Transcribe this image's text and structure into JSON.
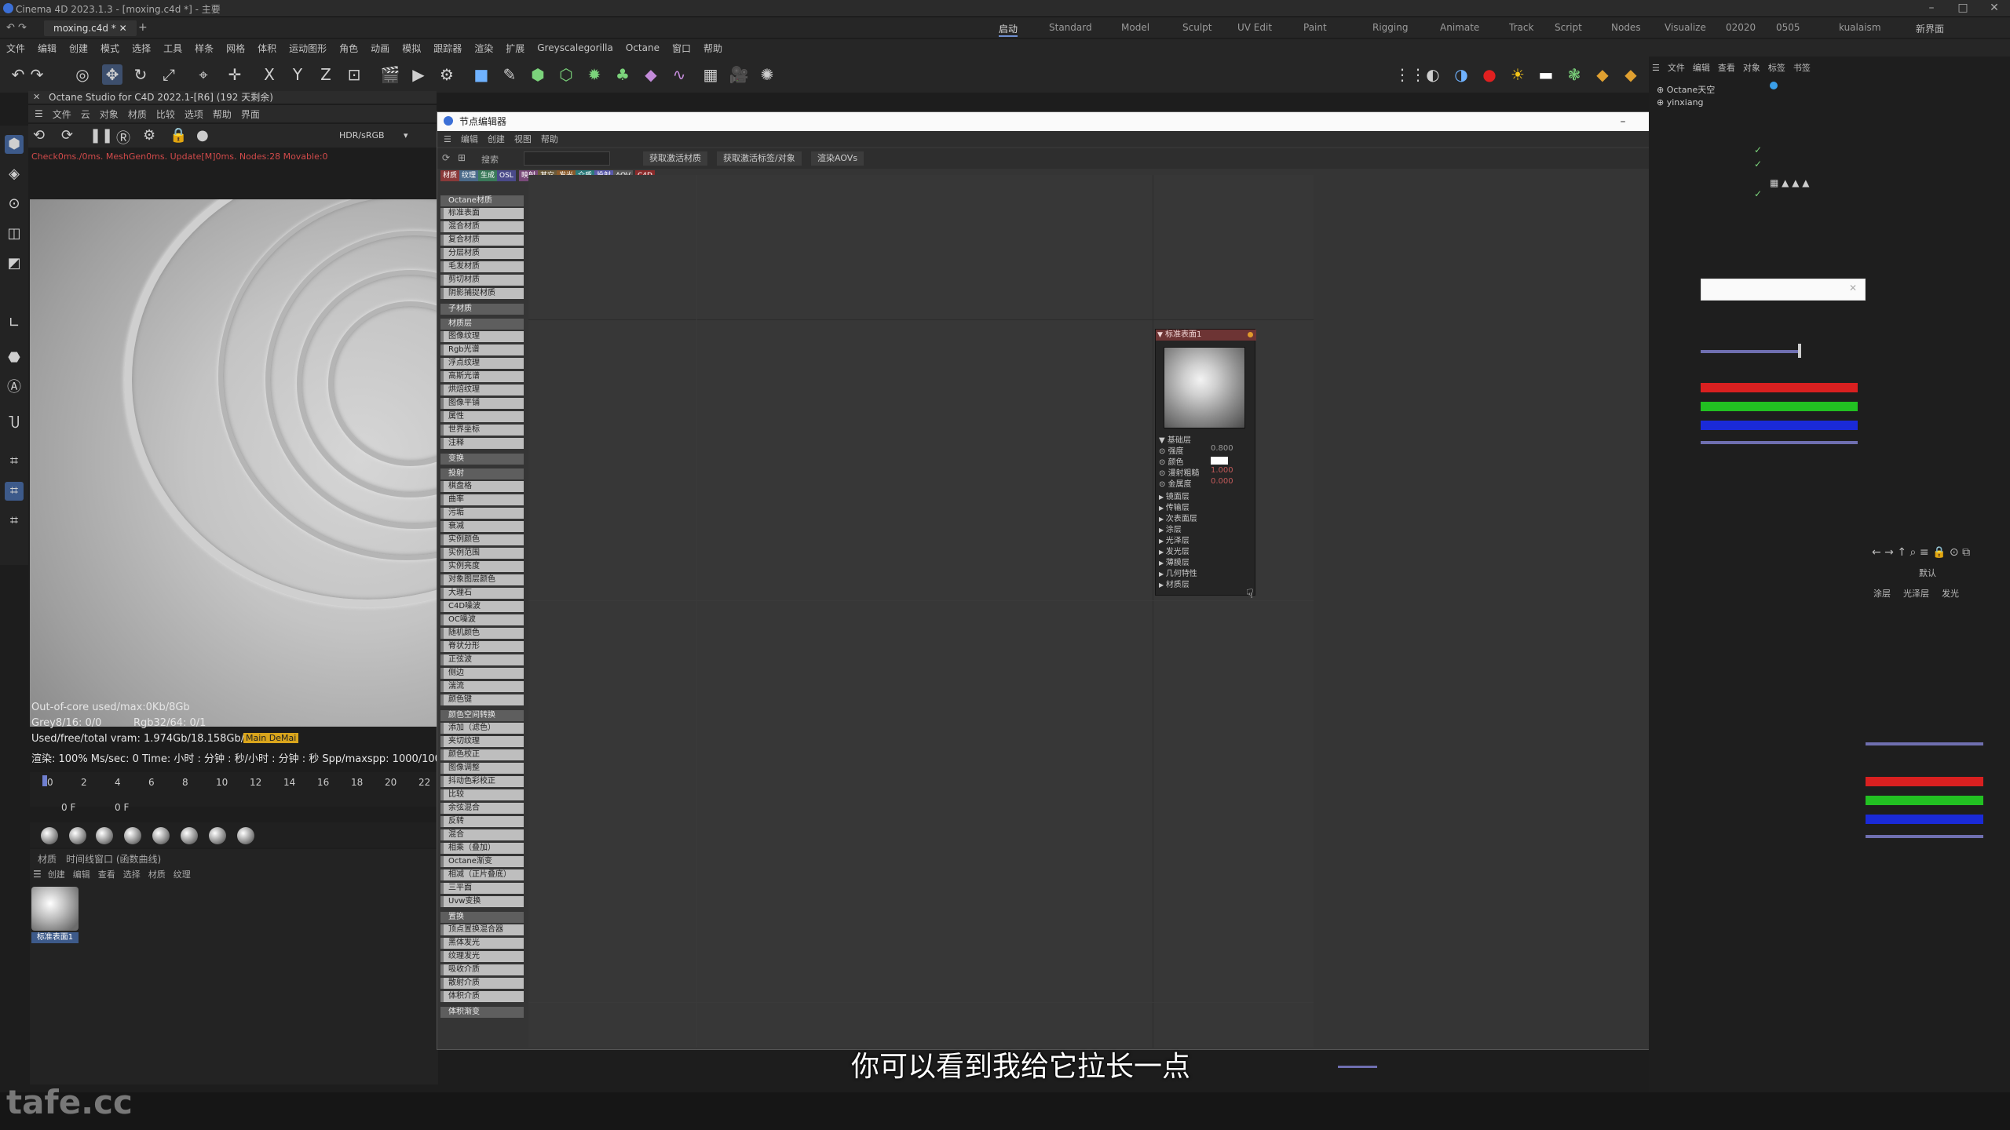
{
  "titlebar": {
    "title": "Cinema 4D 2023.1.3 - [moxing.c4d *] - 主要"
  },
  "tabs": {
    "file_tab": "moxing.c4d *",
    "layouts": [
      "启动",
      "Standard",
      "Model",
      "Sculpt",
      "UV Edit",
      "Paint",
      "Rigging",
      "Animate",
      "Track",
      "Script",
      "Nodes",
      "Visualize",
      "02020",
      "0505",
      "kualaism"
    ],
    "new_layout": "新界面"
  },
  "menubar": {
    "items": [
      "文件",
      "编辑",
      "创建",
      "模式",
      "选择",
      "工具",
      "样条",
      "网格",
      "体积",
      "运动图形",
      "角色",
      "动画",
      "模拟",
      "跟踪器",
      "渲染",
      "扩展",
      "Greyscalegorilla",
      "Octane",
      "窗口",
      "帮助"
    ]
  },
  "octane": {
    "title": "Octane Studio for C4D 2022.1-[R6] (192 天剩余)",
    "menu": [
      "文件",
      "云",
      "对象",
      "材质",
      "比较",
      "选项",
      "帮助",
      "界面"
    ],
    "mode": "HDR/sRGB",
    "status": "Check0ms./0ms. MeshGen0ms. Update[M]0ms. Nodes:28 Movable:0"
  },
  "stats": {
    "line1": "Out-of-core used/max:0Kb/8Gb",
    "line2a": "Grey8/16: 0/0",
    "line2b": "Rgb32/64: 0/1",
    "line3": "Used/free/total vram: 1.974Gb/18.158Gb/2",
    "badge": "Main DeMai",
    "line4": "渲染: 100%   Ms/sec: 0   Time: 小时 : 分钟 : 秒/小时 : 分钟 : 秒   Spp/maxspp: 1000/100"
  },
  "timeline": {
    "ticks": [
      "0",
      "2",
      "4",
      "6",
      "8",
      "10",
      "12",
      "14",
      "16",
      "18",
      "20",
      "22"
    ],
    "frame_a": "0 F",
    "frame_b": "0 F"
  },
  "materials": {
    "tabs": [
      "材质",
      "时间线窗口 (函数曲线)"
    ],
    "menu": [
      "创建",
      "编辑",
      "查看",
      "选择",
      "材质",
      "纹理"
    ],
    "item": "标准表面1"
  },
  "node_editor": {
    "title": "节点编辑器",
    "menu": [
      "编辑",
      "创建",
      "视图",
      "帮助"
    ],
    "search_label": "搜索",
    "buttons": [
      "获取激活材质",
      "获取激活标签/对象",
      "渲染AOVs"
    ],
    "color_tabs": [
      {
        "label": "材质",
        "color": "#8a3a3a"
      },
      {
        "label": "纹理",
        "color": "#4a6a8a"
      },
      {
        "label": "生成",
        "color": "#3a7a5a"
      },
      {
        "label": "OSL",
        "color": "#4a4a8a"
      },
      {
        "label": "映射",
        "color": "#7a4a7a"
      },
      {
        "label": "其它",
        "color": "#6a5a3a"
      },
      {
        "label": "发光",
        "color": "#8a5a2a"
      },
      {
        "label": "介质",
        "color": "#2a7a7a"
      },
      {
        "label": "投射",
        "color": "#5a5aaa"
      },
      {
        "label": "AOV",
        "color": "#555555"
      },
      {
        "label": "C4D",
        "color": "#8a2a2a"
      }
    ],
    "list": [
      {
        "label": "Octane材质",
        "h": true
      },
      {
        "label": "标准表面"
      },
      {
        "label": "混合材质"
      },
      {
        "label": "复合材质"
      },
      {
        "label": "分层材质"
      },
      {
        "label": "毛发材质"
      },
      {
        "label": "剪切材质"
      },
      {
        "label": "阴影捕捉材质"
      },
      {
        "label": "子材质",
        "h": true
      },
      {
        "label": "材质层",
        "h": true
      },
      {
        "label": "图像纹理"
      },
      {
        "label": "Rgb光谱"
      },
      {
        "label": "浮点纹理"
      },
      {
        "label": "高斯光谱"
      },
      {
        "label": "烘焙纹理"
      },
      {
        "label": "图像平铺"
      },
      {
        "label": "属性"
      },
      {
        "label": "世界坐标"
      },
      {
        "label": "注释"
      },
      {
        "label": "变换",
        "h": true
      },
      {
        "label": "投射",
        "h": true
      },
      {
        "label": "棋盘格"
      },
      {
        "label": "曲率"
      },
      {
        "label": "污垢"
      },
      {
        "label": "衰减"
      },
      {
        "label": "实例颜色"
      },
      {
        "label": "实例范围"
      },
      {
        "label": "实例亮度"
      },
      {
        "label": "对象图层颜色"
      },
      {
        "label": "大理石"
      },
      {
        "label": "C4D噪波"
      },
      {
        "label": "OC噪波"
      },
      {
        "label": "随机颜色"
      },
      {
        "label": "脊状分形"
      },
      {
        "label": "正弦波"
      },
      {
        "label": "侧边"
      },
      {
        "label": "湍流"
      },
      {
        "label": "颜色键"
      },
      {
        "label": "颜色空间转换",
        "h": true
      },
      {
        "label": "添加（滤色）"
      },
      {
        "label": "夹切纹理"
      },
      {
        "label": "颜色校正"
      },
      {
        "label": "图像调整"
      },
      {
        "label": "抖动色彩校正"
      },
      {
        "label": "比较"
      },
      {
        "label": "余弦混合"
      },
      {
        "label": "反转"
      },
      {
        "label": "混合"
      },
      {
        "label": "相乘（叠加）"
      },
      {
        "label": "Octane渐变"
      },
      {
        "label": "相减（正片叠底）"
      },
      {
        "label": "三平面"
      },
      {
        "label": "Uvw变换"
      },
      {
        "label": "置换",
        "h": true
      },
      {
        "label": "顶点置换混合器"
      },
      {
        "label": "黑体发光"
      },
      {
        "label": "纹理发光"
      },
      {
        "label": "吸收介质"
      },
      {
        "label": "散射介质"
      },
      {
        "label": "体积介质"
      },
      {
        "label": "体积渐变",
        "h": true
      }
    ],
    "node": {
      "title": "标准表面1",
      "section": "基础层",
      "params": [
        {
          "label": "强度",
          "value": "0.800"
        },
        {
          "label": "颜色",
          "value": ""
        },
        {
          "label": "漫射粗糙",
          "value": "1.000"
        },
        {
          "label": "金属度",
          "value": "0.000"
        }
      ],
      "groups": [
        "镜面层",
        "传输层",
        "次表面层",
        "涂层",
        "光泽层",
        "发光层",
        "薄膜层",
        "几何特性",
        "材质层"
      ]
    }
  },
  "objects": {
    "rows": [
      "Octane天空",
      "yinxiang"
    ]
  },
  "attr": {
    "tabs": [
      "涂层",
      "光泽层",
      "发光"
    ],
    "default": "默认"
  },
  "subtitle": "你可以看到我给它拉长一点",
  "watermark": "tafe.cc",
  "colors": {
    "accent": "#3d5a8a",
    "red": "#d92020",
    "green": "#22c022",
    "blue": "#1a2ad8"
  }
}
